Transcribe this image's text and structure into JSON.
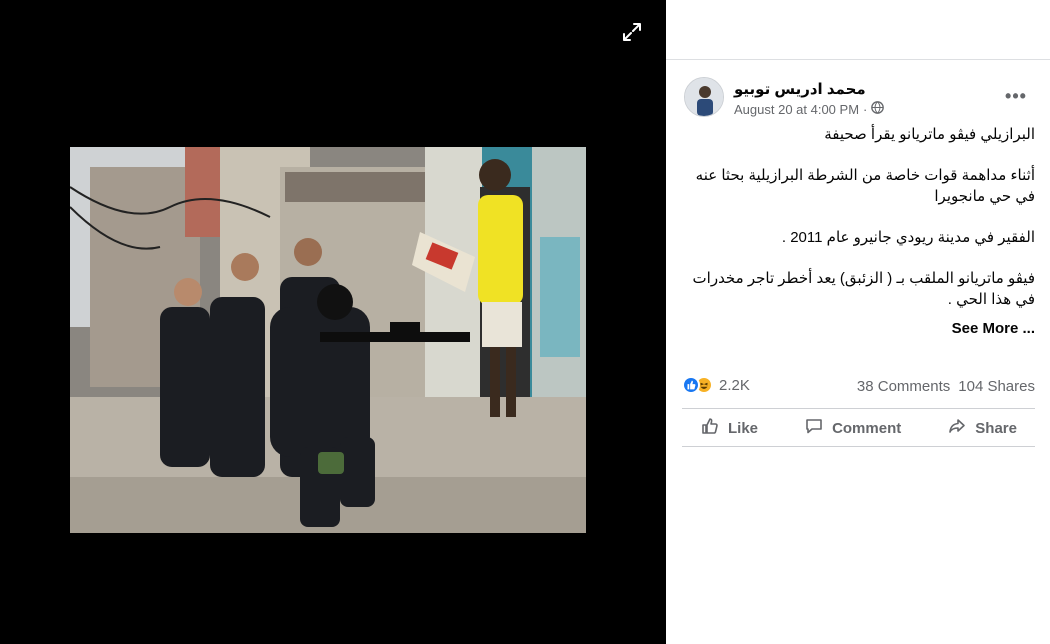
{
  "post": {
    "author": "محمد ادريس توبيو",
    "timestamp": "August 20 at 4:00 PM",
    "separator": "·",
    "audience_icon": "globe-icon",
    "paragraphs": [
      "البرازيلي فيڤو ماتريانو يقرأ صحيفة",
      "أثناء مداهمة قوات خاصة من الشرطة البرازيلية بحثا عنه في حي مانجويرا",
      "الفقير في مدينة ريودي جانيرو عام 2011 .",
      "فيڤو ماتريانو الملقب بـ ( الزئبق) يعد أخطر تاجر مخدرات في هذا الحي ."
    ],
    "see_more": "See More ...",
    "more_icon": "•••"
  },
  "engagement": {
    "reaction_count": "2.2K",
    "reaction_icons": [
      "like-icon",
      "haha-icon"
    ],
    "comments": "38 Comments",
    "shares": "104 Shares"
  },
  "actions": {
    "like": "Like",
    "comment": "Comment",
    "share": "Share"
  },
  "colors": {
    "like_blue": "#1877f2",
    "haha_yellow": "#f7b125",
    "secondary_text": "#65676b"
  }
}
